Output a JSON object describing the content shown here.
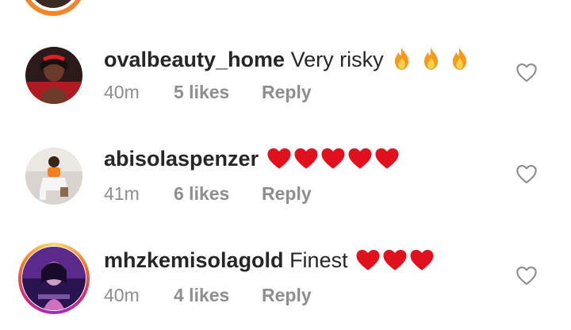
{
  "comments": [
    {
      "username": "ovalbeauty_home",
      "text": "Very risky",
      "emoji": [
        "fire",
        "fire",
        "fire"
      ],
      "time": "40m",
      "likes": "5 likes",
      "reply": "Reply"
    },
    {
      "username": "abisolaspenzer",
      "text": "",
      "emoji": [
        "heart",
        "heart",
        "heart",
        "heart",
        "heart"
      ],
      "time": "41m",
      "likes": "6 likes",
      "reply": "Reply"
    },
    {
      "username": "mhzkemisolagold",
      "text": "Finest",
      "emoji": [
        "heart",
        "heart",
        "heart"
      ],
      "time": "40m",
      "likes": "4 likes",
      "reply": "Reply"
    }
  ],
  "colors": {
    "heart": "#e0101c",
    "meta_text": "#8e8e8e",
    "username": "#262626",
    "story_ring": [
      "#feda75",
      "#fa7e1e",
      "#d62976",
      "#962fbf"
    ]
  },
  "icons": {
    "like_button": "heart-outline-icon",
    "fire_emoji": "fire-icon",
    "heart_emoji": "heart-icon"
  }
}
